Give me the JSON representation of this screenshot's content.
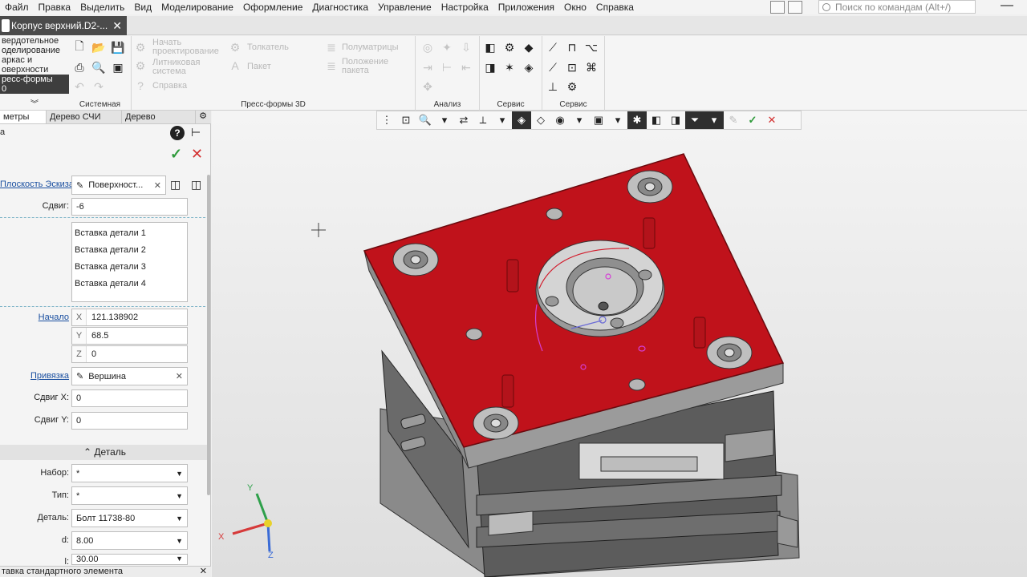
{
  "menu": [
    "Файл",
    "Правка",
    "Выделить",
    "Вид",
    "Моделирование",
    "Оформление",
    "Диагностика",
    "Управление",
    "Настройка",
    "Приложения",
    "Окно",
    "Справка"
  ],
  "search_placeholder": "Поиск по командам (Alt+/)",
  "doc_tab": {
    "title": "Корпус верхний.D2-...",
    "close": "✕"
  },
  "modes": [
    {
      "label": "вердотельное\nоделирование",
      "active": false
    },
    {
      "label": "аркас и\nоверхности",
      "active": false
    },
    {
      "label": "ресс-формы\n0",
      "active": true
    }
  ],
  "ribbon": {
    "groups": [
      "Системная",
      "Пресс-формы 3D",
      "Анализ",
      "Сервис",
      "Сервис"
    ],
    "press_form_items": [
      "Начать\nпроектирование",
      "Литниковая\nсистема",
      "Справка",
      "Толкатель",
      "Пакет",
      "Полуматрицы",
      "Положение\nпакета"
    ]
  },
  "panel": {
    "tabs": [
      "метры",
      "Дерево СЧИ",
      "Дерево"
    ],
    "sketch_plane_label": "Плоскость Эскиза",
    "sketch_plane_value": "Поверхност...",
    "shift_label": "Сдвиг:",
    "shift_value": "-6",
    "inserts": [
      "Вставка детали 1",
      "Вставка детали 2",
      "Вставка детали 3",
      "Вставка детали 4"
    ],
    "start_label": "Начало",
    "start_x": "121.138902",
    "start_y": "68.5",
    "start_z": "0",
    "binding_label": "Привязка",
    "binding_value": "Вершина",
    "shift_x_label": "Сдвиг X:",
    "shift_x_value": "0",
    "shift_y_label": "Сдвиг Y:",
    "shift_y_value": "0",
    "detail_section": "Деталь",
    "set_label": "Набор:",
    "set_value": "*",
    "type_label": "Тип:",
    "type_value": "*",
    "detail_label": "Деталь:",
    "detail_value": "Болт 11738-80",
    "d_label": "d:",
    "d_value": "8.00",
    "l_label": "l:",
    "l_value": "30.00",
    "status_text": "тавка стандартного элемента"
  },
  "axis_labels": {
    "x": "X",
    "y": "Y",
    "z": "Z"
  },
  "colors": {
    "plate_red": "#c0121b",
    "active_mode": "#3e3e3e",
    "ok_green": "#2e9a3a",
    "cancel_red": "#d32f2f"
  }
}
